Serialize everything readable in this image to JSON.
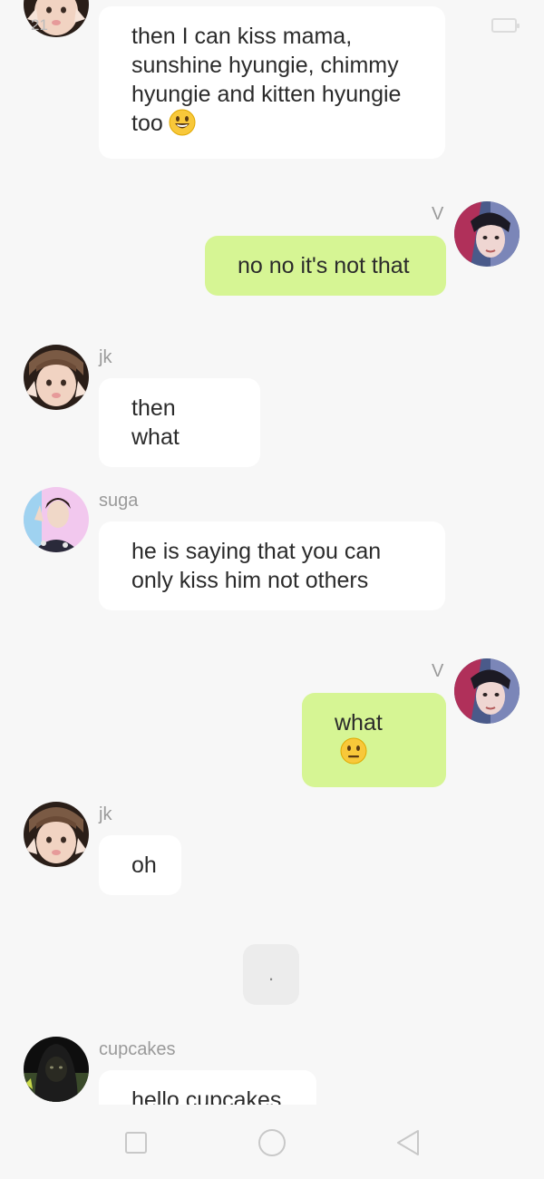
{
  "status_bar": {
    "clock": "21"
  },
  "messages": [
    {
      "sender": "",
      "text": "then I can kiss mama, sunshine hyungie, chimmy hyungie and kitten hyungie too",
      "emoji": "grinning-face",
      "direction": "incoming"
    },
    {
      "sender": "V",
      "text": "no no it's not that",
      "direction": "outgoing"
    },
    {
      "sender": "jk",
      "text": "then what",
      "direction": "incoming"
    },
    {
      "sender": "suga",
      "text": "he is saying that you can only kiss him not others",
      "direction": "incoming"
    },
    {
      "sender": "V",
      "text": "what",
      "emoji": "neutral-face",
      "direction": "outgoing"
    },
    {
      "sender": "jk",
      "text": "oh",
      "direction": "incoming"
    },
    {
      "sender": "",
      "text": ".",
      "direction": "system"
    },
    {
      "sender": "cupcakes",
      "text": "hello cupcakes",
      "direction": "incoming"
    }
  ],
  "nav_bar": {
    "icons": [
      "square-recents-icon",
      "circle-home-icon",
      "triangle-back-icon"
    ]
  },
  "colors": {
    "background": "#f7f7f7",
    "incoming_bubble": "#ffffff",
    "outgoing_bubble": "#d6f594",
    "name_text": "#9a9a9a"
  }
}
